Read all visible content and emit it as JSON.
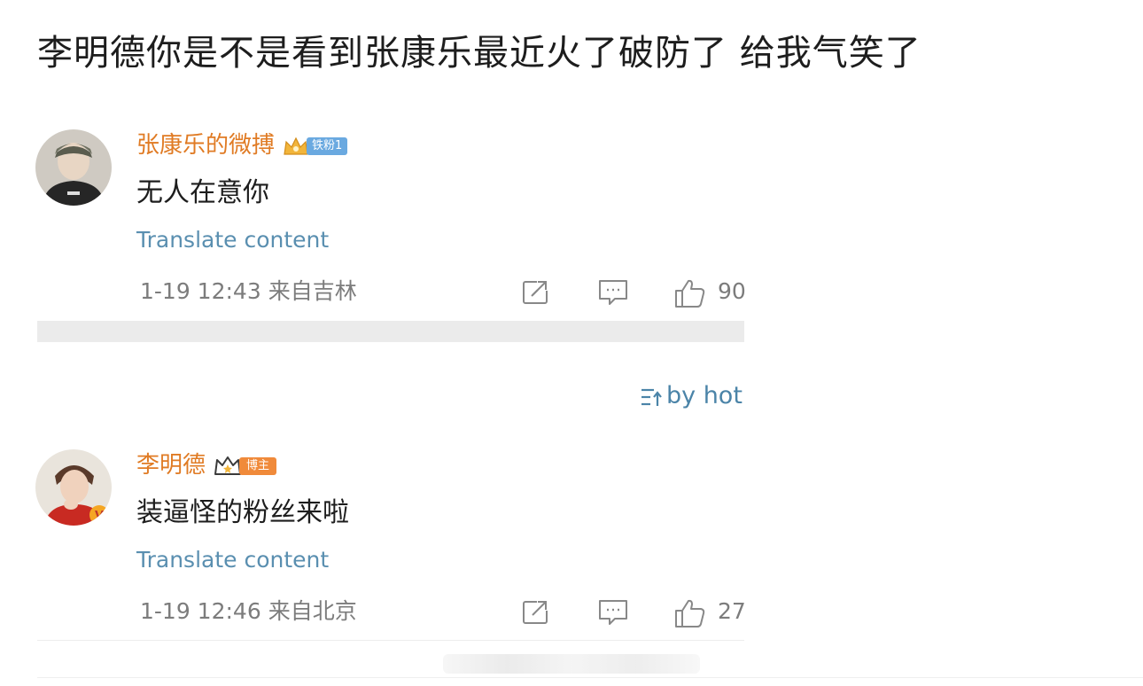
{
  "post": {
    "title": "李明德你是不是看到张康乐最近火了破防了 给我气笑了"
  },
  "comments": [
    {
      "username": "张康乐的微搏",
      "badge": "铁粉1",
      "text": "无人在意你",
      "translate_label": "Translate content",
      "date": "1-19 12:43",
      "location": "来自吉林",
      "likes": "90"
    },
    {
      "username": "李明德",
      "badge": "博主",
      "text": "装逼怪的粉丝来啦",
      "translate_label": "Translate content",
      "date": "1-19 12:46",
      "location": "来自北京",
      "likes": "27"
    }
  ],
  "sort": {
    "label": "by hot"
  },
  "icons": {
    "share": "share-icon",
    "comment": "comment-icon",
    "like": "thumbs-up-icon",
    "sort": "sort-icon",
    "crown": "crown-icon"
  },
  "colors": {
    "username": "#e07b24",
    "link": "#5a8fb0",
    "meta": "#7c7c7c",
    "fan_badge": "#6aa9e0",
    "blogger_badge": "#f08a3a"
  }
}
